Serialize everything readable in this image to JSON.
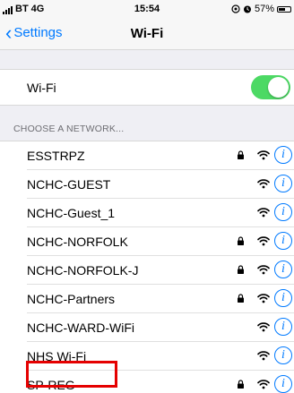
{
  "status_bar": {
    "carrier": "BT",
    "network_type": "4G",
    "time": "15:54",
    "battery_percent": "57%",
    "battery_level": 0.57,
    "signal_icon": "signal-bars-icon",
    "location_icon": "location-icon",
    "alarm_icon": "alarm-icon"
  },
  "nav": {
    "back_label": "Settings",
    "title": "Wi-Fi"
  },
  "wifi_toggle": {
    "label": "Wi-Fi",
    "on": true,
    "on_color": "#4cd964"
  },
  "section_header": "CHOOSE A NETWORK...",
  "networks": [
    {
      "name": "ESSTRPZ",
      "locked": true
    },
    {
      "name": "NCHC-GUEST",
      "locked": false
    },
    {
      "name": "NCHC-Guest_1",
      "locked": false
    },
    {
      "name": "NCHC-NORFOLK",
      "locked": true
    },
    {
      "name": "NCHC-NORFOLK-J",
      "locked": true
    },
    {
      "name": "NCHC-Partners",
      "locked": true
    },
    {
      "name": "NCHC-WARD-WiFi",
      "locked": false
    },
    {
      "name": "NHS Wi-Fi",
      "locked": false,
      "highlighted": true
    },
    {
      "name": "SP-REG",
      "locked": true
    }
  ],
  "colors": {
    "accent": "#007aff",
    "highlight": "#e50000",
    "background": "#efeff4"
  },
  "icons": {
    "lock": "lock-icon",
    "wifi": "wifi-signal-icon",
    "info": "info-icon",
    "back": "chevron-left-icon"
  }
}
